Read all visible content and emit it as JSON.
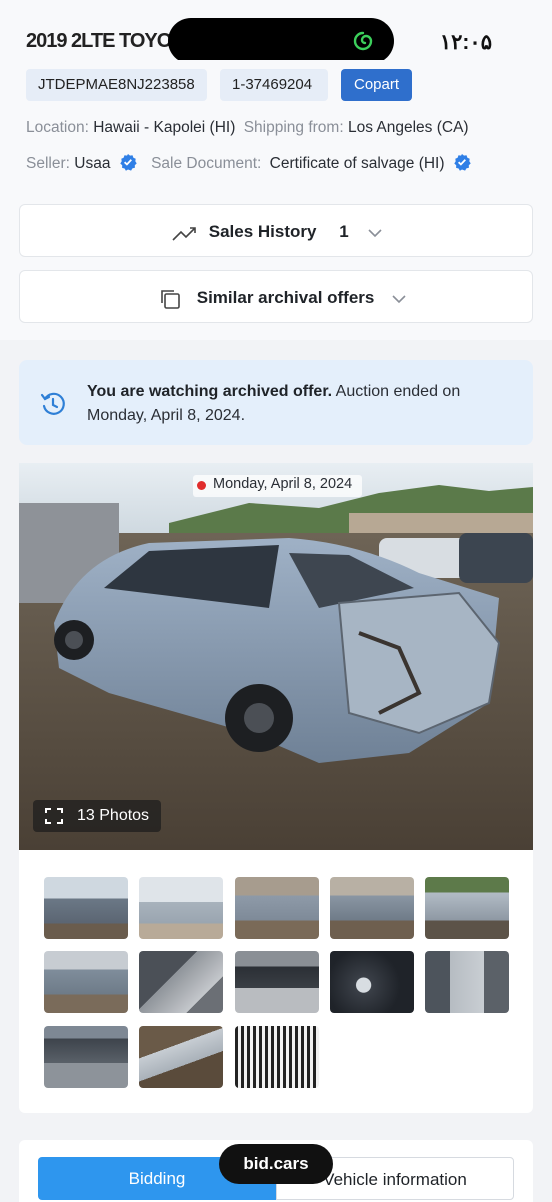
{
  "status_bar": {
    "left_text": "2019 2LTE TOYOT",
    "time": "۱۲:۰۵"
  },
  "header": {
    "vin": "JTDEPMAE8NJ223858",
    "lot": "1-37469204",
    "auction": "Copart",
    "location_label": "Location:",
    "location_value": "Hawaii - Kapolei (HI)",
    "shipping_label": "Shipping from:",
    "shipping_value": "Los Angeles (CA)",
    "seller_label": "Seller:",
    "seller_value": "Usaa",
    "doc_label": "Sale Document:",
    "doc_value": "Certificate of salvage (HI)"
  },
  "sales_history": {
    "label": "Sales History",
    "count": "1"
  },
  "similar_offers": {
    "label": "Similar archival offers"
  },
  "banner": {
    "bold": "You are watching archived offer.",
    "rest": " Auction ended on Monday, April 8, 2024."
  },
  "gallery": {
    "date": "Monday, April 8, 2024",
    "photos_label": "13 Photos",
    "thumbnails": [
      "photo-1",
      "photo-2",
      "photo-3",
      "photo-4",
      "photo-5",
      "photo-6",
      "photo-7",
      "photo-8",
      "photo-9",
      "photo-10",
      "photo-11",
      "photo-12",
      "photo-13"
    ]
  },
  "tabs": {
    "bidding": "Bidding",
    "vehicle_info": "Vehicle information"
  },
  "brand": "bid.cars",
  "colors": {
    "accent": "#2e96ee",
    "copart": "#2f6fcc",
    "banner_bg": "#e4effb",
    "verified": "#2f7fe6"
  },
  "icons": [
    "swirl-icon",
    "verified-icon",
    "trend-icon",
    "chevron-down-icon",
    "copy-icon",
    "history-icon",
    "expand-icon"
  ]
}
